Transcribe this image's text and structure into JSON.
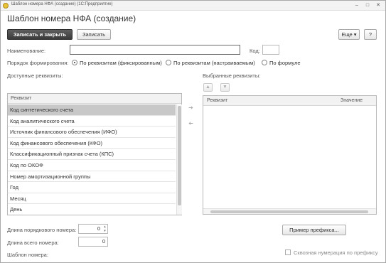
{
  "window": {
    "title": "Шаблон номера НФА (создание) (1С:Предприятие)",
    "minimize": "–",
    "maximize": "□",
    "close": "✕"
  },
  "form": {
    "title": "Шаблон номера НФА (создание)"
  },
  "toolbar": {
    "save_close_label": "Записать и закрыть",
    "save_label": "Записать",
    "more_label": "Еще ▾",
    "help_label": "?"
  },
  "fields": {
    "name_label": "Наименование:",
    "name_value": "",
    "code_label": "Код:",
    "code_value": "",
    "order_label": "Порядок формирования:",
    "order_options": [
      "По реквизитам (фиксированным)",
      "По реквизитам (настраиваемым)",
      "По формуле"
    ],
    "order_selected": "По реквизитам (фиксированным)"
  },
  "available": {
    "label": "Доступные реквизиты:",
    "column_header": "Реквизит",
    "items": [
      "Код синтетического счета",
      "Код аналитического счета",
      "Источник финансового обеспечения (ИФО)",
      "Код финансового обеспечения (КФО)",
      "Классификационный признак счета (КПС)",
      "Код по ОКОФ",
      "Номер амортизационной группы",
      "Год",
      "Месяц",
      "День"
    ],
    "selected_index": 0
  },
  "transfer": {
    "add_icon": "arrow-right",
    "remove_icon": "arrow-left"
  },
  "selected": {
    "label": "Выбранные реквизиты:",
    "move_up_icon": "arrow-up",
    "move_down_icon": "arrow-down",
    "columns": [
      "Реквизит",
      "Значение"
    ]
  },
  "bottom": {
    "seq_length_label": "Длина порядкового номера:",
    "seq_length_value": "0",
    "total_length_label": "Длина всего номера:",
    "total_length_value": "0",
    "template_label": "Шаблон номера:",
    "prefix_example_label": "Пример префикса...",
    "through_numbering_label": "Сквозная нумерация по префиксу",
    "through_numbering_checked": false
  }
}
